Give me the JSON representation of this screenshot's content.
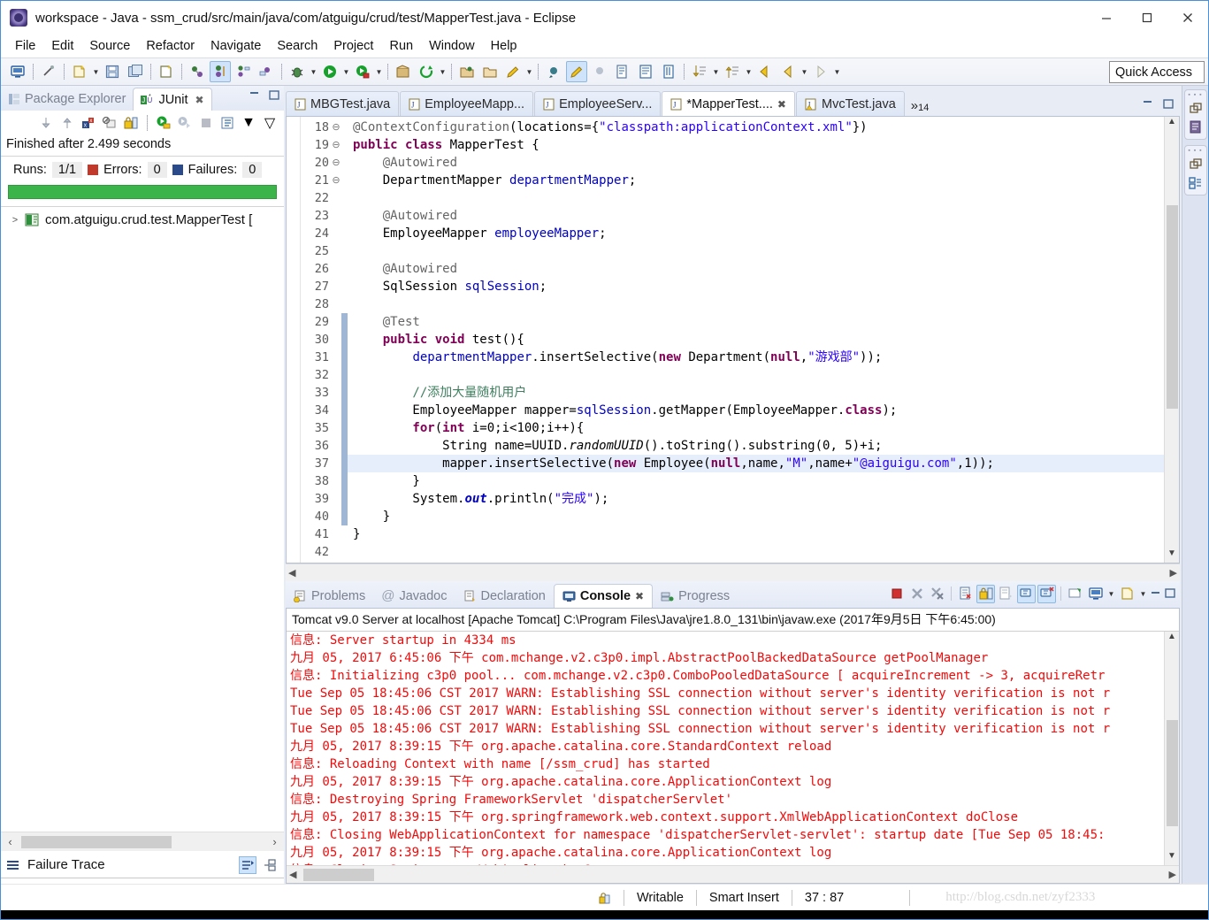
{
  "window": {
    "title": "workspace - Java - ssm_crud/src/main/java/com/atguigu/crud/test/MapperTest.java - Eclipse",
    "minimize_label": "─",
    "maximize_label": "□",
    "close_label": "✕"
  },
  "menubar": {
    "items": [
      "File",
      "Edit",
      "Source",
      "Refactor",
      "Navigate",
      "Search",
      "Project",
      "Run",
      "Window",
      "Help"
    ]
  },
  "toolbar": {
    "quick_access_placeholder": "Quick Access"
  },
  "left_view": {
    "tabs": [
      {
        "label": "Package Explorer",
        "selected": false,
        "closable": false
      },
      {
        "label": "JUnit",
        "selected": true,
        "closable": true
      }
    ],
    "status": "Finished after 2.499 seconds",
    "counts": {
      "runs_label": "Runs:",
      "runs_value": "1/1",
      "errors_label": "Errors:",
      "errors_value": "0",
      "failures_label": "Failures:",
      "failures_value": "0"
    },
    "progress_color": "#3bb54a",
    "tree": [
      {
        "label": "com.atguigu.crud.test.MapperTest [",
        "expandable": true
      }
    ],
    "failure_trace_label": "Failure Trace"
  },
  "editor": {
    "tabs": [
      {
        "label": "MBGTest.java",
        "selected": false,
        "dirty": false,
        "warning": false
      },
      {
        "label": "EmployeeMapp...",
        "selected": false,
        "dirty": false,
        "warning": false
      },
      {
        "label": "EmployeeServ...",
        "selected": false,
        "dirty": false,
        "warning": false
      },
      {
        "label": "*MapperTest....",
        "selected": true,
        "dirty": true,
        "warning": false
      },
      {
        "label": "MvcTest.java",
        "selected": false,
        "dirty": false,
        "warning": true
      }
    ],
    "overflow_label": "»",
    "overflow_count": "14",
    "first_line_number": 18,
    "lines": [
      {
        "n": 18,
        "fold": "",
        "changed": false,
        "highlight": false,
        "tokens": [
          {
            "t": "@ContextConfiguration",
            "c": "ann"
          },
          {
            "t": "(locations={",
            "c": ""
          },
          {
            "t": "\"classpath:applicationContext.xml\"",
            "c": "str"
          },
          {
            "t": "})",
            "c": ""
          }
        ]
      },
      {
        "n": 19,
        "fold": "",
        "changed": false,
        "highlight": false,
        "tokens": [
          {
            "t": "public class ",
            "c": "kw"
          },
          {
            "t": "MapperTest {",
            "c": ""
          }
        ]
      },
      {
        "n": 20,
        "fold": "⊖",
        "changed": false,
        "highlight": false,
        "tokens": [
          {
            "t": "    @Autowired",
            "c": "ann"
          }
        ]
      },
      {
        "n": 21,
        "fold": "",
        "changed": false,
        "highlight": false,
        "tokens": [
          {
            "t": "    DepartmentMapper ",
            "c": ""
          },
          {
            "t": "departmentMapper",
            "c": "fld"
          },
          {
            "t": ";",
            "c": ""
          }
        ]
      },
      {
        "n": 22,
        "fold": "",
        "changed": false,
        "highlight": false,
        "tokens": []
      },
      {
        "n": 23,
        "fold": "⊖",
        "changed": false,
        "highlight": false,
        "tokens": [
          {
            "t": "    @Autowired",
            "c": "ann"
          }
        ]
      },
      {
        "n": 24,
        "fold": "",
        "changed": false,
        "highlight": false,
        "tokens": [
          {
            "t": "    EmployeeMapper ",
            "c": ""
          },
          {
            "t": "employeeMapper",
            "c": "fld"
          },
          {
            "t": ";",
            "c": ""
          }
        ]
      },
      {
        "n": 25,
        "fold": "",
        "changed": false,
        "highlight": false,
        "tokens": []
      },
      {
        "n": 26,
        "fold": "⊖",
        "changed": false,
        "highlight": false,
        "tokens": [
          {
            "t": "    @Autowired",
            "c": "ann"
          }
        ]
      },
      {
        "n": 27,
        "fold": "",
        "changed": false,
        "highlight": false,
        "tokens": [
          {
            "t": "    SqlSession ",
            "c": ""
          },
          {
            "t": "sqlSession",
            "c": "fld"
          },
          {
            "t": ";",
            "c": ""
          }
        ]
      },
      {
        "n": 28,
        "fold": "",
        "changed": false,
        "highlight": false,
        "tokens": []
      },
      {
        "n": 29,
        "fold": "⊖",
        "changed": true,
        "highlight": false,
        "tokens": [
          {
            "t": "    @Test",
            "c": "ann"
          }
        ]
      },
      {
        "n": 30,
        "fold": "",
        "changed": true,
        "highlight": false,
        "tokens": [
          {
            "t": "    public void ",
            "c": "kw"
          },
          {
            "t": "test(){",
            "c": ""
          }
        ]
      },
      {
        "n": 31,
        "fold": "",
        "changed": true,
        "highlight": false,
        "tokens": [
          {
            "t": "        ",
            "c": ""
          },
          {
            "t": "departmentMapper",
            "c": "fld"
          },
          {
            "t": ".insertSelective(",
            "c": ""
          },
          {
            "t": "new ",
            "c": "kw"
          },
          {
            "t": "Department(",
            "c": ""
          },
          {
            "t": "null",
            "c": "kw"
          },
          {
            "t": ",",
            "c": ""
          },
          {
            "t": "\"游戏部\"",
            "c": "str"
          },
          {
            "t": "));",
            "c": ""
          }
        ]
      },
      {
        "n": 32,
        "fold": "",
        "changed": true,
        "highlight": false,
        "tokens": []
      },
      {
        "n": 33,
        "fold": "",
        "changed": true,
        "highlight": false,
        "tokens": [
          {
            "t": "        //添加大量随机用户",
            "c": "cmt"
          }
        ]
      },
      {
        "n": 34,
        "fold": "",
        "changed": true,
        "highlight": false,
        "tokens": [
          {
            "t": "        EmployeeMapper mapper=",
            "c": ""
          },
          {
            "t": "sqlSession",
            "c": "fld"
          },
          {
            "t": ".getMapper(EmployeeMapper.",
            "c": ""
          },
          {
            "t": "class",
            "c": "kw"
          },
          {
            "t": ");",
            "c": ""
          }
        ]
      },
      {
        "n": 35,
        "fold": "",
        "changed": true,
        "highlight": false,
        "tokens": [
          {
            "t": "        for",
            "c": "kw"
          },
          {
            "t": "(",
            "c": ""
          },
          {
            "t": "int ",
            "c": "kw"
          },
          {
            "t": "i=0;i<100;i++){",
            "c": ""
          }
        ]
      },
      {
        "n": 36,
        "fold": "",
        "changed": true,
        "highlight": false,
        "tokens": [
          {
            "t": "            String name=UUID.",
            "c": ""
          },
          {
            "t": "randomUUID",
            "c": "ital"
          },
          {
            "t": "().toString().substring(0, 5)+i;",
            "c": ""
          }
        ]
      },
      {
        "n": 37,
        "fold": "",
        "changed": true,
        "highlight": true,
        "tokens": [
          {
            "t": "            mapper.insertSelective(",
            "c": ""
          },
          {
            "t": "new ",
            "c": "kw"
          },
          {
            "t": "Employee(",
            "c": ""
          },
          {
            "t": "null",
            "c": "kw"
          },
          {
            "t": ",name,",
            "c": ""
          },
          {
            "t": "\"M\"",
            "c": "str"
          },
          {
            "t": ",name+",
            "c": ""
          },
          {
            "t": "\"@aiguigu.com\"",
            "c": "str"
          },
          {
            "t": ",1));",
            "c": ""
          }
        ]
      },
      {
        "n": 38,
        "fold": "",
        "changed": true,
        "highlight": false,
        "tokens": [
          {
            "t": "        }",
            "c": ""
          }
        ]
      },
      {
        "n": 39,
        "fold": "",
        "changed": true,
        "highlight": false,
        "tokens": [
          {
            "t": "        System.",
            "c": ""
          },
          {
            "t": "out",
            "c": "ital-b"
          },
          {
            "t": ".println(",
            "c": ""
          },
          {
            "t": "\"完成\"",
            "c": "str"
          },
          {
            "t": ");",
            "c": ""
          }
        ]
      },
      {
        "n": 40,
        "fold": "",
        "changed": true,
        "highlight": false,
        "tokens": [
          {
            "t": "    }",
            "c": ""
          }
        ]
      },
      {
        "n": 41,
        "fold": "",
        "changed": false,
        "highlight": false,
        "tokens": [
          {
            "t": "}",
            "c": ""
          }
        ]
      },
      {
        "n": 42,
        "fold": "",
        "changed": false,
        "highlight": false,
        "tokens": []
      }
    ]
  },
  "console_panel": {
    "tabs": [
      {
        "label": "Problems",
        "selected": false,
        "closable": false
      },
      {
        "label": "Javadoc",
        "selected": false,
        "closable": false
      },
      {
        "label": "Declaration",
        "selected": false,
        "closable": false
      },
      {
        "label": "Console",
        "selected": true,
        "closable": true
      },
      {
        "label": "Progress",
        "selected": false,
        "closable": false
      }
    ],
    "title": "Tomcat v9.0 Server at localhost [Apache Tomcat] C:\\Program Files\\Java\\jre1.8.0_131\\bin\\javaw.exe (2017年9月5日 下午6:45:00)",
    "text_color": "#f00b0b",
    "lines": [
      "信息: Server startup in 4334 ms",
      "九月 05, 2017 6:45:06 下午 com.mchange.v2.c3p0.impl.AbstractPoolBackedDataSource getPoolManager",
      "信息: Initializing c3p0 pool... com.mchange.v2.c3p0.ComboPooledDataSource [ acquireIncrement -> 3, acquireRetr",
      "Tue Sep 05 18:45:06 CST 2017 WARN: Establishing SSL connection without server's identity verification is not r",
      "Tue Sep 05 18:45:06 CST 2017 WARN: Establishing SSL connection without server's identity verification is not r",
      "Tue Sep 05 18:45:06 CST 2017 WARN: Establishing SSL connection without server's identity verification is not r",
      "九月 05, 2017 8:39:15 下午 org.apache.catalina.core.StandardContext reload",
      "信息: Reloading Context with name [/ssm_crud] has started",
      "九月 05, 2017 8:39:15 下午 org.apache.catalina.core.ApplicationContext log",
      "信息: Destroying Spring FrameworkServlet 'dispatcherServlet'",
      "九月 05, 2017 8:39:15 下午 org.springframework.web.context.support.XmlWebApplicationContext doClose",
      "信息: Closing WebApplicationContext for namespace 'dispatcherServlet-servlet': startup date [Tue Sep 05 18:45:",
      "九月 05, 2017 8:39:15 下午 org.apache.catalina.core.ApplicationContext log",
      "信息: Closing Spring root WebApplicationContext"
    ]
  },
  "statusbar": {
    "writable": "Writable",
    "insert_mode": "Smart Insert",
    "position": "37 : 87",
    "watermark": "http://blog.csdn.net/zyf2333"
  }
}
